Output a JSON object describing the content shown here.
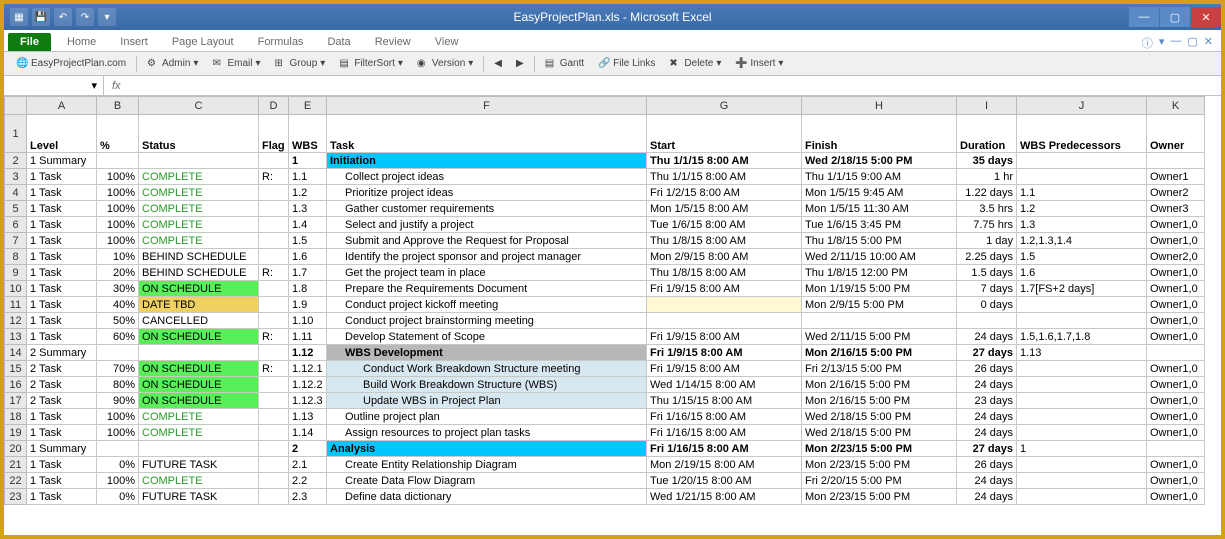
{
  "titlebar": {
    "title": "EasyProjectPlan.xls  -  Microsoft Excel"
  },
  "ribbon": {
    "file": "File",
    "tabs": [
      "Home",
      "Insert",
      "Page Layout",
      "Formulas",
      "Data",
      "Review",
      "View"
    ]
  },
  "toolbar": {
    "items": [
      "EasyProjectPlan.com",
      "Admin",
      "Email",
      "Group",
      "FilterSort",
      "Version",
      "Gantt",
      "File Links",
      "Delete",
      "Insert"
    ]
  },
  "namebox": "",
  "fx_label": "fx",
  "columns": [
    "A",
    "B",
    "C",
    "D",
    "E",
    "F",
    "G",
    "H",
    "I",
    "J",
    "K"
  ],
  "headers": {
    "A": "Level",
    "B": "%",
    "C": "Status",
    "D": "Flag",
    "E": "WBS",
    "F": "Task",
    "G": "Start",
    "H": "Finish",
    "I": "Duration",
    "J": "WBS Predecessors",
    "K": "Owner"
  },
  "rows": [
    {
      "n": 2,
      "level": "1 Summary",
      "pct": "",
      "status": "",
      "flag": "",
      "wbs": "1",
      "task": "Initiation",
      "start": "Thu 1/1/15 8:00 AM",
      "finish": "Wed 2/18/15 5:00 PM",
      "dur": "35 days",
      "pred": "",
      "owner": "",
      "cls": "summary",
      "boldDates": true
    },
    {
      "n": 3,
      "level": "1 Task",
      "pct": "100%",
      "status": "COMPLETE",
      "flag": "R:",
      "wbs": "1.1",
      "task": "Collect project ideas",
      "start": "Thu 1/1/15 8:00 AM",
      "finish": "Thu 1/1/15 9:00 AM",
      "dur": "1 hr",
      "pred": "",
      "owner": "Owner1",
      "cls": "complete"
    },
    {
      "n": 4,
      "level": "1 Task",
      "pct": "100%",
      "status": "COMPLETE",
      "flag": "",
      "wbs": "1.2",
      "task": "Prioritize project ideas",
      "start": "Fri 1/2/15 8:00 AM",
      "finish": "Mon 1/5/15 9:45 AM",
      "dur": "1.22 days",
      "pred": "1.1",
      "owner": "Owner2",
      "cls": "complete"
    },
    {
      "n": 5,
      "level": "1 Task",
      "pct": "100%",
      "status": "COMPLETE",
      "flag": "",
      "wbs": "1.3",
      "task": "Gather customer requirements",
      "start": "Mon 1/5/15 8:00 AM",
      "finish": "Mon 1/5/15 11:30 AM",
      "dur": "3.5 hrs",
      "pred": "1.2",
      "owner": "Owner3",
      "cls": "complete"
    },
    {
      "n": 6,
      "level": "1 Task",
      "pct": "100%",
      "status": "COMPLETE",
      "flag": "",
      "wbs": "1.4",
      "task": "Select and justify a project",
      "start": "Tue 1/6/15 8:00 AM",
      "finish": "Tue 1/6/15 3:45 PM",
      "dur": "7.75 hrs",
      "pred": "1.3",
      "owner": "Owner1,0",
      "cls": "complete"
    },
    {
      "n": 7,
      "level": "1 Task",
      "pct": "100%",
      "status": "COMPLETE",
      "flag": "",
      "wbs": "1.5",
      "task": "Submit and Approve the Request for Proposal",
      "start": "Thu 1/8/15 8:00 AM",
      "finish": "Thu 1/8/15 5:00 PM",
      "dur": "1 day",
      "pred": "1.2,1.3,1.4",
      "owner": "Owner1,0",
      "cls": "complete"
    },
    {
      "n": 8,
      "level": "1 Task",
      "pct": "10%",
      "status": "BEHIND SCHEDULE",
      "flag": "",
      "wbs": "1.6",
      "task": "Identify the project sponsor and project manager",
      "start": "Mon 2/9/15 8:00 AM",
      "finish": "Wed 2/11/15 10:00 AM",
      "dur": "2.25 days",
      "pred": "1.5",
      "owner": "Owner2,0",
      "cls": "behind"
    },
    {
      "n": 9,
      "level": "1 Task",
      "pct": "20%",
      "status": "BEHIND SCHEDULE",
      "flag": "R:",
      "wbs": "1.7",
      "task": "Get the project team in place",
      "start": "Thu 1/8/15 8:00 AM",
      "finish": "Thu 1/8/15 12:00 PM",
      "dur": "1.5 days",
      "pred": "1.6",
      "owner": "Owner1,0",
      "cls": "behind"
    },
    {
      "n": 10,
      "level": "1 Task",
      "pct": "30%",
      "status": "ON SCHEDULE",
      "flag": "",
      "wbs": "1.8",
      "task": "Prepare the Requirements Document",
      "start": "Fri 1/9/15 8:00 AM",
      "finish": "Mon 1/19/15 5:00 PM",
      "dur": "7 days",
      "pred": "1.7[FS+2 days]",
      "owner": "Owner1,0",
      "cls": "onschedule"
    },
    {
      "n": 11,
      "level": "1 Task",
      "pct": "40%",
      "status": "DATE TBD",
      "flag": "",
      "wbs": "1.9",
      "task": "Conduct project kickoff meeting",
      "start": "",
      "finish": "Mon 2/9/15 5:00 PM",
      "dur": "0 days",
      "pred": "",
      "owner": "Owner1,0",
      "cls": "datetbd",
      "yellowStart": true
    },
    {
      "n": 12,
      "level": "1 Task",
      "pct": "50%",
      "status": "CANCELLED",
      "flag": "",
      "wbs": "1.10",
      "task": "Conduct project brainstorming meeting",
      "start": "",
      "finish": "",
      "dur": "",
      "pred": "",
      "owner": "Owner1,0",
      "cls": "cancelled"
    },
    {
      "n": 13,
      "level": "1 Task",
      "pct": "60%",
      "status": "ON SCHEDULE",
      "flag": "R:",
      "wbs": "1.11",
      "task": "Develop Statement of Scope",
      "start": "Fri 1/9/15 8:00 AM",
      "finish": "Wed 2/11/15 5:00 PM",
      "dur": "24 days",
      "pred": "1.5,1.6,1.7,1.8",
      "owner": "Owner1,0",
      "cls": "onschedule"
    },
    {
      "n": 14,
      "level": "2 Summary",
      "pct": "",
      "status": "",
      "flag": "",
      "wbs": "1.12",
      "task": "WBS Development",
      "start": "Fri 1/9/15 8:00 AM",
      "finish": "Mon 2/16/15 5:00 PM",
      "dur": "27 days",
      "pred": "1.13",
      "owner": "",
      "cls": "wbsdev",
      "boldDates": true
    },
    {
      "n": 15,
      "level": "2 Task",
      "pct": "70%",
      "status": "ON SCHEDULE",
      "flag": "R:",
      "wbs": "1.12.1",
      "task": "Conduct Work Breakdown Structure meeting",
      "start": "Fri 1/9/15 8:00 AM",
      "finish": "Fri 2/13/15 5:00 PM",
      "dur": "26 days",
      "pred": "",
      "owner": "Owner1,0",
      "cls": "onschedule sub2"
    },
    {
      "n": 16,
      "level": "2 Task",
      "pct": "80%",
      "status": "ON SCHEDULE",
      "flag": "",
      "wbs": "1.12.2",
      "task": "Build Work Breakdown Structure (WBS)",
      "start": "Wed 1/14/15 8:00 AM",
      "finish": "Mon 2/16/15 5:00 PM",
      "dur": "24 days",
      "pred": "",
      "owner": "Owner1,0",
      "cls": "onschedule sub2"
    },
    {
      "n": 17,
      "level": "2 Task",
      "pct": "90%",
      "status": "ON SCHEDULE",
      "flag": "",
      "wbs": "1.12.3",
      "task": "Update WBS in Project Plan",
      "start": "Thu 1/15/15 8:00 AM",
      "finish": "Mon 2/16/15 5:00 PM",
      "dur": "23 days",
      "pred": "",
      "owner": "Owner1,0",
      "cls": "onschedule sub2"
    },
    {
      "n": 18,
      "level": "1 Task",
      "pct": "100%",
      "status": "COMPLETE",
      "flag": "",
      "wbs": "1.13",
      "task": "Outline project plan",
      "start": "Fri 1/16/15 8:00 AM",
      "finish": "Wed 2/18/15 5:00 PM",
      "dur": "24 days",
      "pred": "",
      "owner": "Owner1,0",
      "cls": "complete"
    },
    {
      "n": 19,
      "level": "1 Task",
      "pct": "100%",
      "status": "COMPLETE",
      "flag": "",
      "wbs": "1.14",
      "task": "Assign resources to project plan tasks",
      "start": "Fri 1/16/15 8:00 AM",
      "finish": "Wed 2/18/15 5:00 PM",
      "dur": "24 days",
      "pred": "",
      "owner": "Owner1,0",
      "cls": "complete"
    },
    {
      "n": 20,
      "level": "1 Summary",
      "pct": "",
      "status": "",
      "flag": "",
      "wbs": "2",
      "task": "Analysis",
      "start": "Fri 1/16/15 8:00 AM",
      "finish": "Mon 2/23/15 5:00 PM",
      "dur": "27 days",
      "pred": "1",
      "owner": "",
      "cls": "summary",
      "boldDates": true
    },
    {
      "n": 21,
      "level": "1 Task",
      "pct": "0%",
      "status": "FUTURE TASK",
      "flag": "",
      "wbs": "2.1",
      "task": "Create Entity Relationship Diagram",
      "start": "Mon 2/19/15 8:00 AM",
      "finish": "Mon 2/23/15 5:00 PM",
      "dur": "26 days",
      "pred": "",
      "owner": "Owner1,0",
      "cls": "future"
    },
    {
      "n": 22,
      "level": "1 Task",
      "pct": "100%",
      "status": "COMPLETE",
      "flag": "",
      "wbs": "2.2",
      "task": "Create Data Flow Diagram",
      "start": "Tue 1/20/15 8:00 AM",
      "finish": "Fri 2/20/15 5:00 PM",
      "dur": "24 days",
      "pred": "",
      "owner": "Owner1,0",
      "cls": "complete"
    },
    {
      "n": 23,
      "level": "1 Task",
      "pct": "0%",
      "status": "FUTURE TASK",
      "flag": "",
      "wbs": "2.3",
      "task": "Define data dictionary",
      "start": "Wed 1/21/15 8:00 AM",
      "finish": "Mon 2/23/15 5:00 PM",
      "dur": "24 days",
      "pred": "",
      "owner": "Owner1,0",
      "cls": "future"
    }
  ]
}
